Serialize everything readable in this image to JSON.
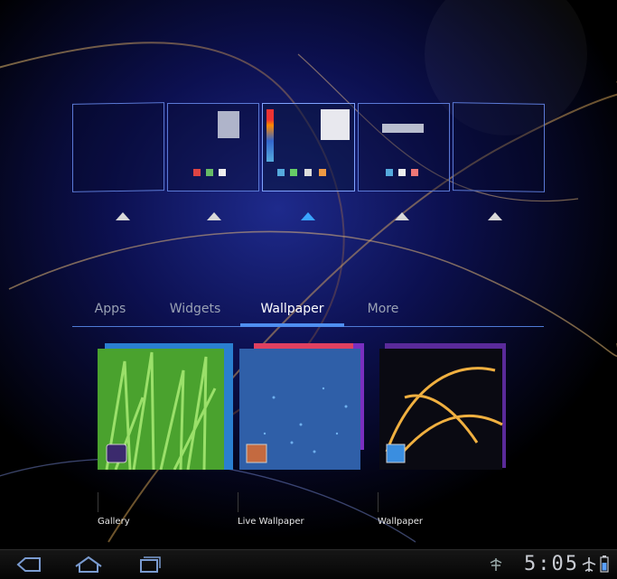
{
  "colors": {
    "accent": "#4f8ff0",
    "frame": "#5b79d6",
    "arrow_active": "#3aa4ff",
    "arrow_idle": "#d8d8d8"
  },
  "home_screens": [
    {
      "name": "home-screen-1",
      "active": false
    },
    {
      "name": "home-screen-2",
      "active": false
    },
    {
      "name": "home-screen-3",
      "active": true
    },
    {
      "name": "home-screen-4",
      "active": false
    },
    {
      "name": "home-screen-5",
      "active": false
    }
  ],
  "tabs": [
    {
      "label": "Apps",
      "active": false
    },
    {
      "label": "Widgets",
      "active": false
    },
    {
      "label": "Wallpaper",
      "active": true
    },
    {
      "label": "More",
      "active": false
    }
  ],
  "wallpaper_sources": [
    {
      "label": "Gallery",
      "icon": "gallery-icon"
    },
    {
      "label": "Live Wallpaper",
      "icon": "live-wallpaper-icon"
    },
    {
      "label": "Wallpaper",
      "icon": "wallpaper-icon"
    }
  ],
  "system_bar": {
    "time": "5:05",
    "icons": [
      "back-icon",
      "home-icon",
      "recent-apps-icon",
      "usb-debug-icon",
      "airplane-mode-icon",
      "battery-icon"
    ]
  }
}
